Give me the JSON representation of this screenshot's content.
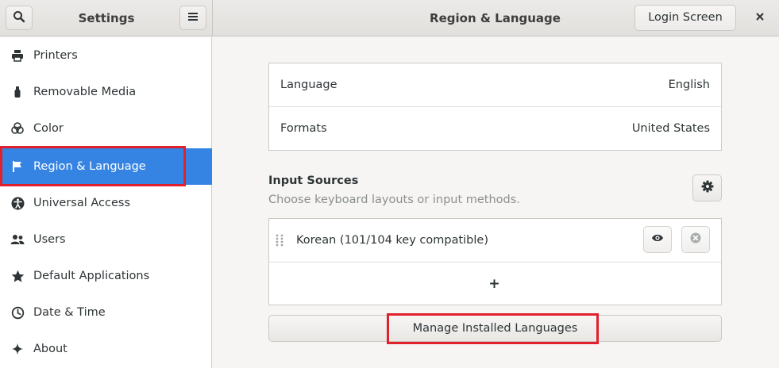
{
  "header": {
    "sidebar_title": "Settings",
    "panel_title": "Region & Language",
    "login_screen_label": "Login Screen"
  },
  "sidebar": {
    "items": [
      {
        "label": "Printers",
        "icon": "printer-icon"
      },
      {
        "label": "Removable Media",
        "icon": "usb-icon"
      },
      {
        "label": "Color",
        "icon": "color-icon"
      },
      {
        "label": "Region & Language",
        "icon": "flag-icon",
        "active": true
      },
      {
        "label": "Universal Access",
        "icon": "accessibility-icon"
      },
      {
        "label": "Users",
        "icon": "users-icon"
      },
      {
        "label": "Default Applications",
        "icon": "star-icon"
      },
      {
        "label": "Date & Time",
        "icon": "clock-icon"
      },
      {
        "label": "About",
        "icon": "sparkle-icon"
      }
    ]
  },
  "region": {
    "language_label": "Language",
    "language_value": "English",
    "formats_label": "Formats",
    "formats_value": "United States"
  },
  "input_sources": {
    "title": "Input Sources",
    "subtitle": "Choose keyboard layouts or input methods.",
    "items": [
      {
        "label": "Korean (101/104 key compatible)"
      }
    ],
    "add_symbol": "+"
  },
  "manage_languages_label": "Manage Installed Languages",
  "colors": {
    "accent": "#3584e4",
    "highlight": "#e0202b"
  }
}
